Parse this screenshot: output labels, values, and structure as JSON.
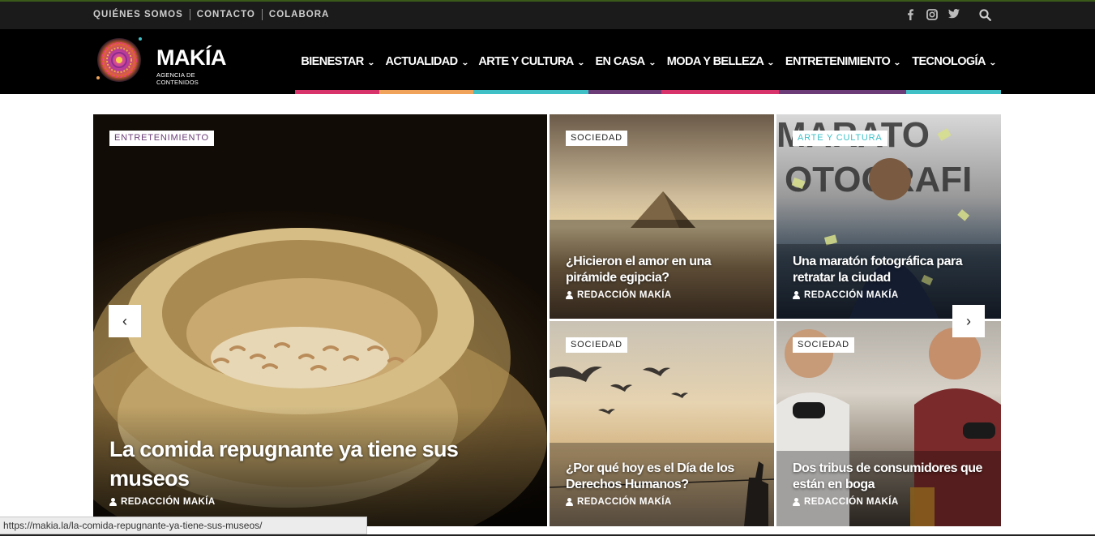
{
  "topbar": {
    "links": [
      "QUIÉNES SOMOS",
      "CONTACTO",
      "COLABORA"
    ],
    "social_icons": [
      "facebook-icon",
      "instagram-icon",
      "twitter-icon"
    ],
    "search_icon": "search-icon"
  },
  "logo": {
    "title": "MAKÍA",
    "subtitle": "AGENCIA DE CONTENIDOS"
  },
  "menu": [
    {
      "label": "BIENESTAR",
      "color": "#d8336a"
    },
    {
      "label": "ACTUALIDAD",
      "color": "#f0a35a"
    },
    {
      "label": "ARTE Y CULTURA",
      "color": "#3fc0c7"
    },
    {
      "label": "EN CASA",
      "color": "#6b3c78"
    },
    {
      "label": "MODA Y BELLEZA",
      "color": "#d8336a"
    },
    {
      "label": "ENTRETENIMIENTO",
      "color": "#6b3c78"
    },
    {
      "label": "TECNOLOGÍA",
      "color": "#3fc0c7"
    }
  ],
  "posts": [
    {
      "tag": "ENTRETENIMIENTO",
      "tag_color": "#6b3c78",
      "title": "La comida repugnante ya tiene sus museos",
      "author": "REDACCIÓN MAKÍA"
    },
    {
      "tag": "SOCIEDAD",
      "tag_color": "#222222",
      "title": "¿Hicieron el amor en una pirámide egipcia?",
      "author": "REDACCIÓN MAKÍA"
    },
    {
      "tag": "ARTE Y CULTURA",
      "tag_color": "#3fc0c7",
      "title": "Una maratón fotográfica para retratar la ciudad",
      "author": "REDACCIÓN MAKÍA"
    },
    {
      "tag": "SOCIEDAD",
      "tag_color": "#222222",
      "title": "¿Por qué hoy es el Día de los Derechos Humanos?",
      "author": "REDACCIÓN MAKÍA"
    },
    {
      "tag": "SOCIEDAD",
      "tag_color": "#222222",
      "title": "Dos tribus de consumidores que están en boga",
      "author": "REDACCIÓN MAKÍA"
    }
  ],
  "slider": {
    "prev": "‹",
    "next": "›"
  },
  "status": {
    "url": "https://makia.la/la-comida-repugnante-ya-tiene-sus-museos/"
  }
}
